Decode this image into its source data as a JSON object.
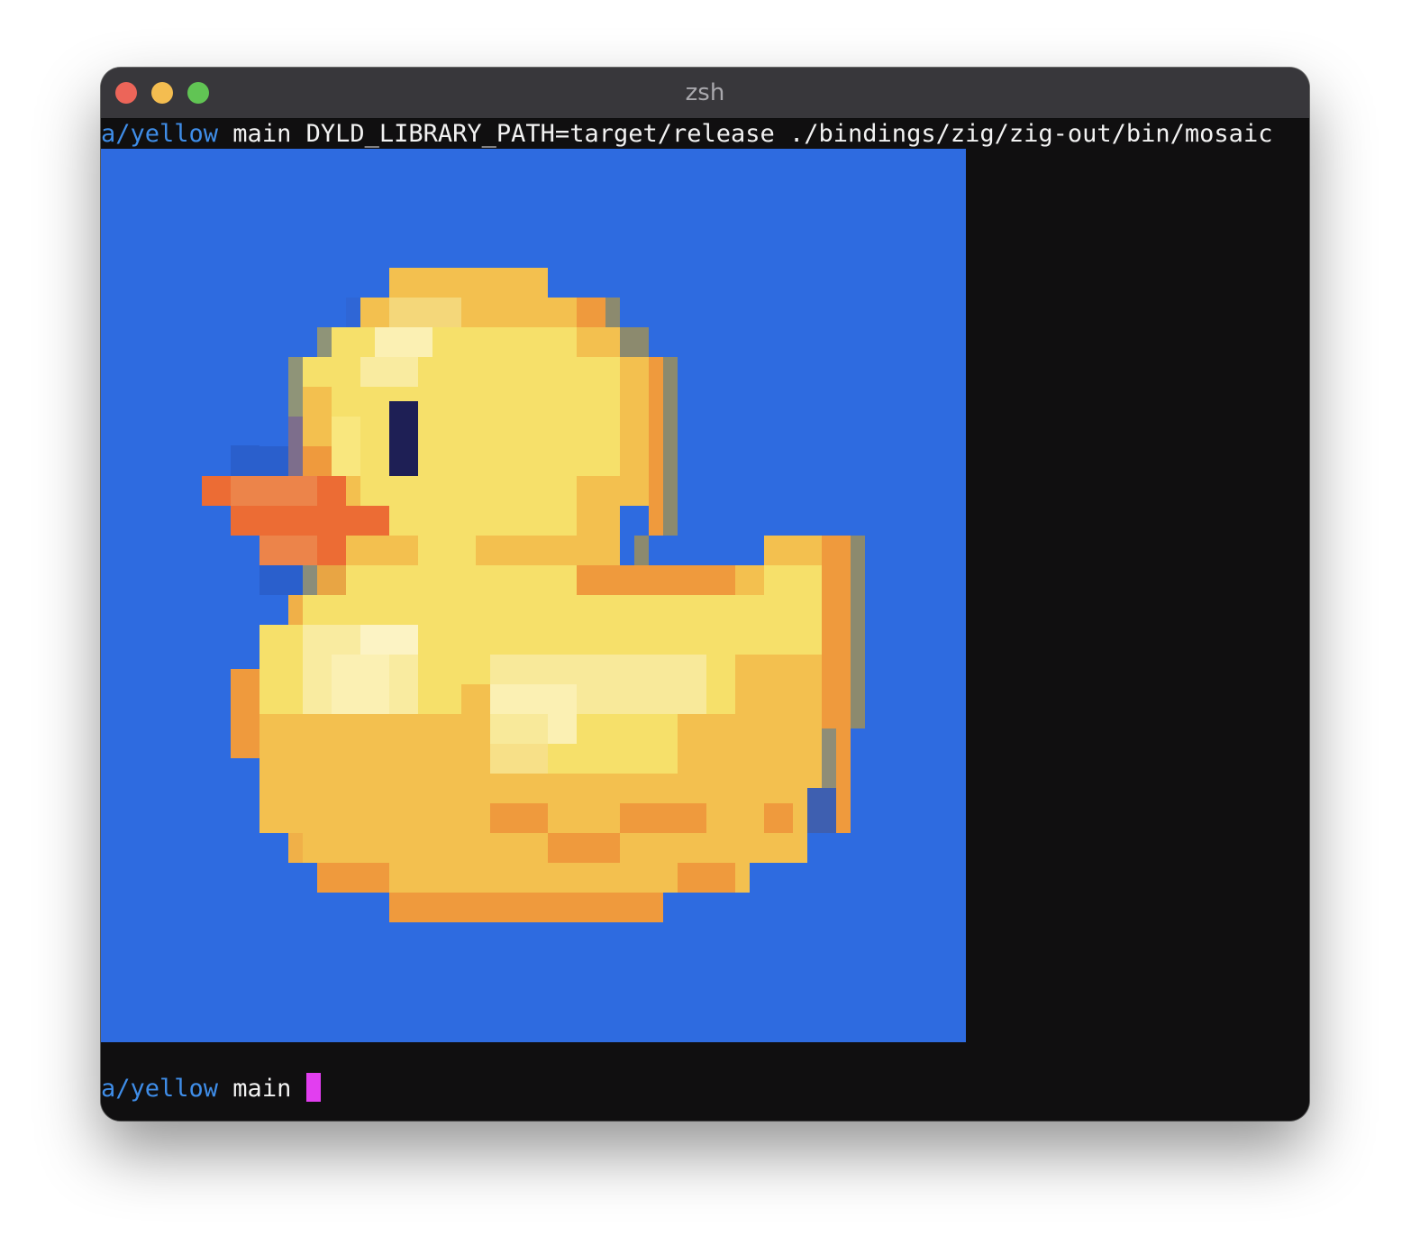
{
  "window": {
    "title": "zsh"
  },
  "terminal": {
    "command_line": {
      "dir": "a/yellow",
      "branch": " main ",
      "command": "DYLD_LIBRARY_PATH=target/release ./bindings/zig/zig-out/bin/mosaic"
    },
    "prompt_line": {
      "dir": "a/yellow",
      "branch": " main "
    }
  },
  "image": {
    "icon": "rubber-duck-pixel-art",
    "colors": {
      "background": "#2e6be0",
      "duck_body": "#f6e06a",
      "duck_shade": "#f3c04f",
      "duck_outline": "#ef9a3d",
      "beak": "#ec6c34",
      "eye": "#1e1f55",
      "highlight": "#fbf0b3"
    }
  },
  "colors": {
    "terminal_bg": "#100f10",
    "titlebar_bg": "#38373b",
    "dir_text": "#3f8de8",
    "cursor": "#e23ef0"
  }
}
